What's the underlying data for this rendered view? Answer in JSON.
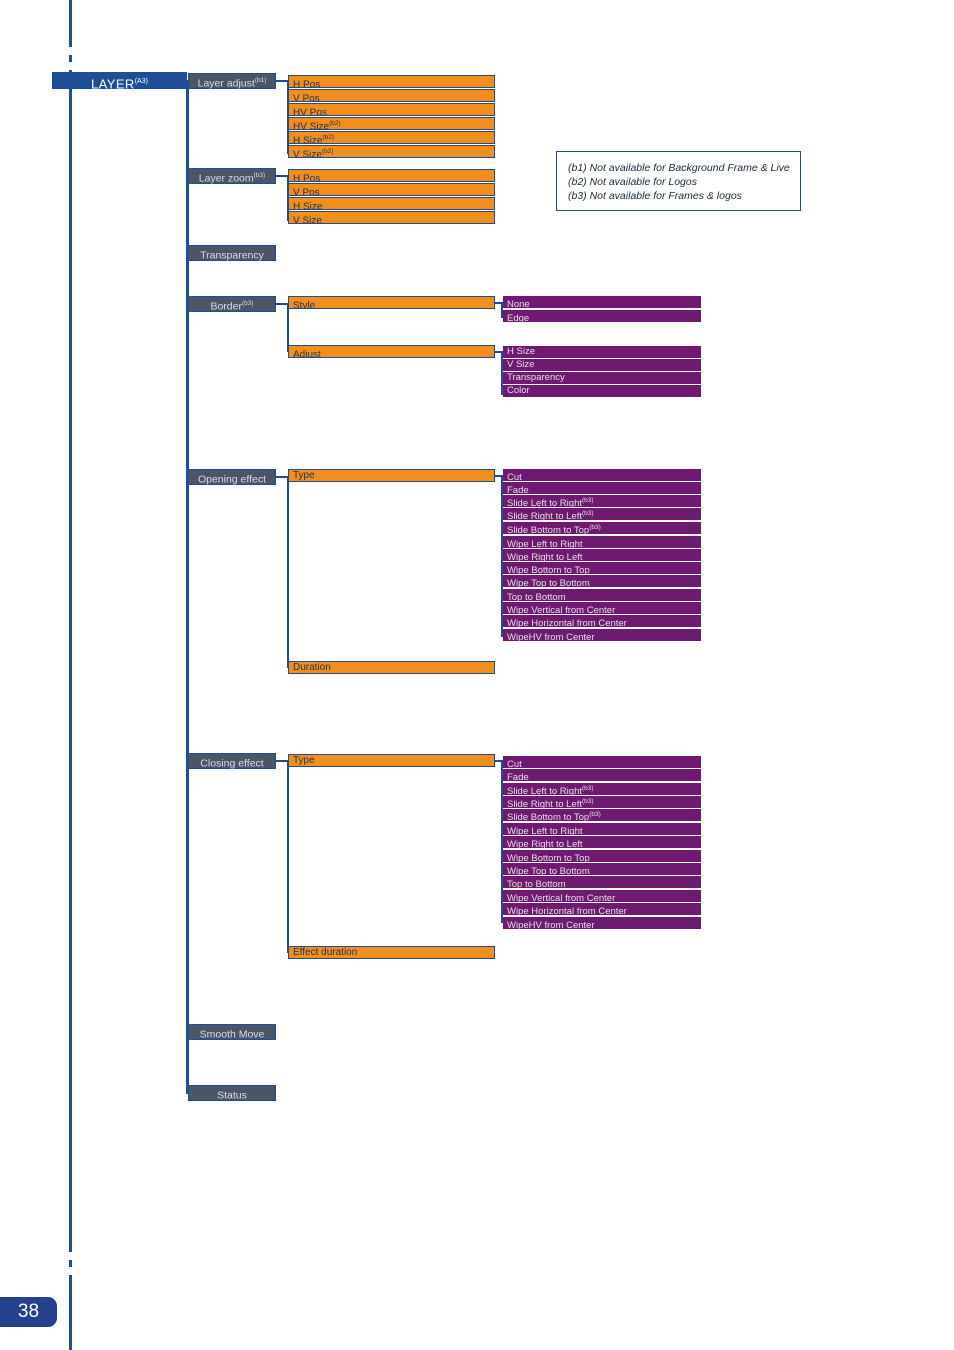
{
  "page": {
    "number": "38"
  },
  "root": {
    "label": "LAYER",
    "sup": "(A3)"
  },
  "legend": {
    "lines": [
      "(b1) Not available for Background Frame & Live",
      "(b2) Not available for Logos",
      "(b3) Not available for Frames & logos"
    ]
  },
  "colors": {
    "root_bar": "#1d4e96",
    "level2_box": "#4c5565",
    "level3_bar": "#f28e1c",
    "level4_bar": "#6f1a70",
    "line": "#1f4e96",
    "page_tab": "#24408e"
  },
  "menu": {
    "layer_adjust": {
      "label": "Layer adjust",
      "sup": "(b1)"
    },
    "layer_adjust_items": [
      {
        "label": "H Pos",
        "sup": ""
      },
      {
        "label": "V Pos",
        "sup": ""
      },
      {
        "label": "HV Pos",
        "sup": ""
      },
      {
        "label": "HV Size",
        "sup": "(b2)"
      },
      {
        "label": "H Size",
        "sup": "(b2)"
      },
      {
        "label": "V Size",
        "sup": "(b2)"
      }
    ],
    "layer_zoom": {
      "label": "Layer zoom",
      "sup": "(b3)"
    },
    "layer_zoom_items": [
      {
        "label": "H Pos",
        "sup": ""
      },
      {
        "label": "V Pos",
        "sup": ""
      },
      {
        "label": "H Size",
        "sup": ""
      },
      {
        "label": "V Size",
        "sup": ""
      }
    ],
    "transparency": {
      "label": "Transparency",
      "sup": ""
    },
    "border": {
      "label": "Border",
      "sup": "(b3)"
    },
    "border_style": {
      "label": "Style",
      "sup": ""
    },
    "border_style_items": [
      {
        "label": "None",
        "sup": ""
      },
      {
        "label": "Edge",
        "sup": ""
      }
    ],
    "border_adjust": {
      "label": "Adjust",
      "sup": ""
    },
    "border_adjust_items": [
      {
        "label": "H Size",
        "sup": ""
      },
      {
        "label": "V Size",
        "sup": ""
      },
      {
        "label": "Transparency",
        "sup": ""
      },
      {
        "label": "Color",
        "sup": ""
      }
    ],
    "opening_effect": {
      "label": "Opening effect",
      "sup": ""
    },
    "opening_type": {
      "label": "Type",
      "sup": ""
    },
    "opening_type_items": [
      {
        "label": "Cut",
        "sup": ""
      },
      {
        "label": "Fade",
        "sup": ""
      },
      {
        "label": "Slide Left to Right",
        "sup": "(b3)"
      },
      {
        "label": "Slide Right to Left",
        "sup": "(b3)"
      },
      {
        "label": "Slide Bottom to Top",
        "sup": "(b3)"
      },
      {
        "label": "Wipe Left to Right",
        "sup": ""
      },
      {
        "label": "Wipe Right to Left",
        "sup": ""
      },
      {
        "label": "Wipe Bottom to Top",
        "sup": ""
      },
      {
        "label": "Wipe Top to Bottom",
        "sup": ""
      },
      {
        "label": "Top to Bottom",
        "sup": ""
      },
      {
        "label": "Wipe Vertical from Center",
        "sup": ""
      },
      {
        "label": "Wipe Horizontal from Center",
        "sup": ""
      },
      {
        "label": "WipeHV from Center",
        "sup": ""
      }
    ],
    "opening_duration": {
      "label": "Duration",
      "sup": ""
    },
    "closing_effect": {
      "label": "Closing effect",
      "sup": ""
    },
    "closing_type": {
      "label": "Type",
      "sup": ""
    },
    "closing_type_items": [
      {
        "label": "Cut",
        "sup": ""
      },
      {
        "label": "Fade",
        "sup": ""
      },
      {
        "label": "Slide Left to Right",
        "sup": "(b3)"
      },
      {
        "label": "Slide Right to Left",
        "sup": "(b3)"
      },
      {
        "label": "Slide Bottom to Top",
        "sup": "(b3)"
      },
      {
        "label": "Wipe Left to Right",
        "sup": ""
      },
      {
        "label": "Wipe Right to Left",
        "sup": ""
      },
      {
        "label": "Wipe Bottom to Top",
        "sup": ""
      },
      {
        "label": "Wipe Top to Bottom",
        "sup": ""
      },
      {
        "label": "Top to Bottom",
        "sup": ""
      },
      {
        "label": "Wipe Vertical from Center",
        "sup": ""
      },
      {
        "label": "Wipe Horizontal from Center",
        "sup": ""
      },
      {
        "label": "WipeHV from Center",
        "sup": ""
      }
    ],
    "closing_duration": {
      "label": "Effect duration",
      "sup": ""
    },
    "smooth_move": {
      "label": "Smooth Move",
      "sup": ""
    },
    "status": {
      "label": "Status",
      "sup": ""
    }
  }
}
